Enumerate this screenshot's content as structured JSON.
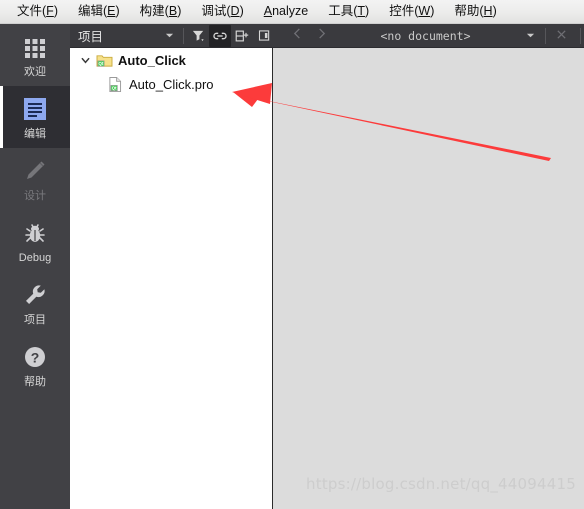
{
  "menubar": {
    "items": [
      {
        "label": "文件(F)",
        "mnemonic": "F"
      },
      {
        "label": "编辑(E)",
        "mnemonic": "E"
      },
      {
        "label": "构建(B)",
        "mnemonic": "B"
      },
      {
        "label": "调试(D)",
        "mnemonic": "D"
      },
      {
        "label": "Analyze",
        "mnemonic": "A"
      },
      {
        "label": "工具(T)",
        "mnemonic": "T"
      },
      {
        "label": "控件(W)",
        "mnemonic": "W"
      },
      {
        "label": "帮助(H)",
        "mnemonic": "H"
      }
    ]
  },
  "activitybar": {
    "items": [
      {
        "label": "欢迎",
        "icon": "grid-icon",
        "state": "normal"
      },
      {
        "label": "编辑",
        "icon": "document-lines-icon",
        "state": "selected"
      },
      {
        "label": "设计",
        "icon": "pencil-icon",
        "state": "disabled"
      },
      {
        "label": "Debug",
        "icon": "bug-icon",
        "state": "normal"
      },
      {
        "label": "项目",
        "icon": "wrench-icon",
        "state": "normal"
      },
      {
        "label": "帮助",
        "icon": "question-circle-icon",
        "state": "normal"
      }
    ]
  },
  "toolbar": {
    "project_selector": "项目",
    "dropdown_icon": "chevron-down-icon",
    "filter_icon": "filter-icon",
    "link_icon": "link-icon",
    "split_icon": "split-add-icon",
    "close_pane_icon": "close-pane-icon",
    "back_icon": "chevron-left-icon",
    "forward_icon": "chevron-right-icon",
    "document_label": "<no document>",
    "document_dropdown_icon": "chevron-down-icon",
    "document_close_icon": "close-icon"
  },
  "tree": {
    "nodes": [
      {
        "label": "Auto_Click",
        "icon": "qt-folder-icon",
        "expanded": true,
        "expander_icon": "chevron-down-icon",
        "bold": true
      },
      {
        "label": "Auto_Click.pro",
        "icon": "qt-profile-icon",
        "bold": false
      }
    ]
  },
  "editor": {
    "watermark": "https://blog.csdn.net/qq_44094415"
  },
  "annotation": {
    "arrow_color": "#fc3b3b",
    "name": "red-arrow-annotation"
  },
  "colors": {
    "menubar_bg": "#ececeb",
    "activitybar_bg": "#414145",
    "toolbar_bg": "#3a3a3e",
    "tree_bg": "#ffffff",
    "editor_bg": "#dcdcdc",
    "selected_item_bg": "#2e2e33",
    "accent_blue": "#8da8ef",
    "qt_green": "#41cd52"
  }
}
